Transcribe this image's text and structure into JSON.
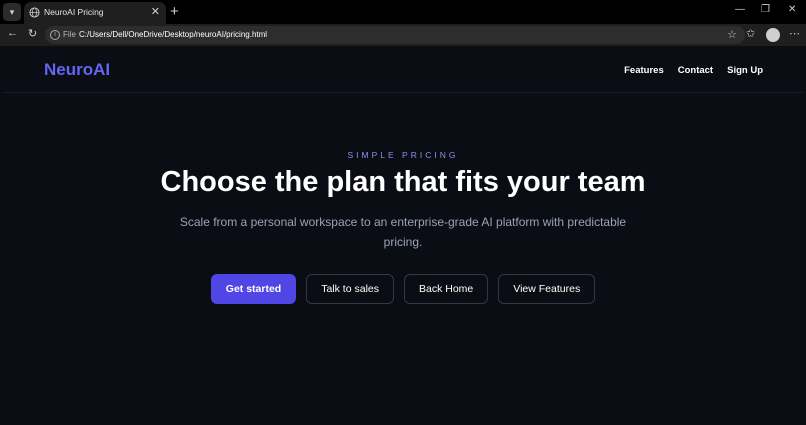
{
  "browser": {
    "tab_title": "NeuroAI Pricing",
    "address_file_label": "File",
    "url": "C:/Users/Dell/OneDrive/Desktop/neuroAI/pricing.html"
  },
  "site": {
    "logo": "NeuroAI",
    "nav": [
      "Features",
      "Contact",
      "Sign Up"
    ]
  },
  "hero": {
    "eyebrow": "SIMPLE PRICING",
    "title": "Choose the plan that fits your team",
    "subtitle": "Scale from a personal workspace to an enterprise-grade AI platform with predictable pricing."
  },
  "cta": {
    "get_started": "Get started",
    "talk_to_sales": "Talk to sales",
    "back_home": "Back Home",
    "view_features": "View Features"
  },
  "colors": {
    "accent": "#6366f1",
    "button_primary": "#4f46e5",
    "background": "#0b0d14"
  },
  "icons": [
    "tab-menu-icon",
    "globe-icon",
    "close-icon",
    "plus-icon",
    "back-icon",
    "reload-icon",
    "info-icon",
    "star-icon",
    "favorites-icon",
    "profile-icon",
    "more-icon"
  ]
}
